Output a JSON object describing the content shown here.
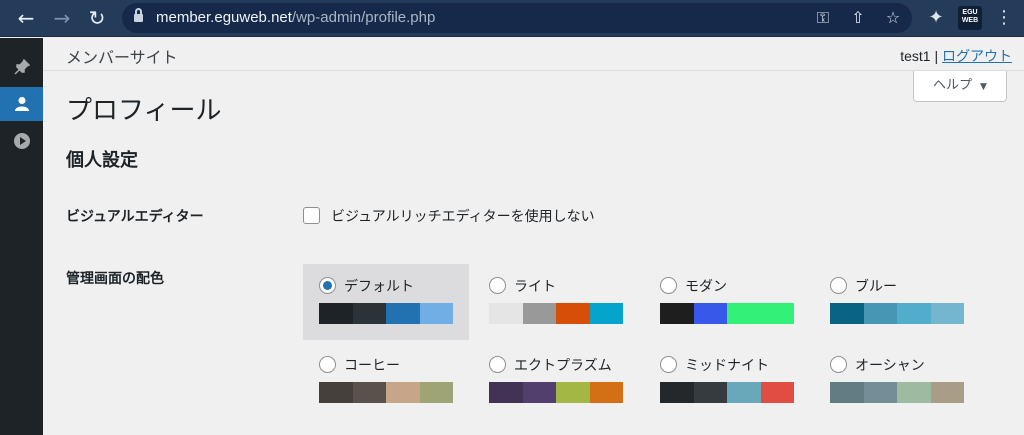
{
  "browser": {
    "url_host": "member.eguweb.net",
    "url_path": "/wp-admin/profile.php",
    "extension_logo_text": "EGU WEB"
  },
  "admin_bar": {
    "site_name": "メンバーサイト",
    "username": "test1",
    "separator": " | ",
    "logout_label": "ログアウト"
  },
  "sidebar": {
    "items": [
      {
        "icon": "pushpin-icon",
        "active": false
      },
      {
        "icon": "user-icon",
        "active": true
      },
      {
        "icon": "media-play-icon",
        "active": false
      }
    ]
  },
  "help_label": "ヘルプ",
  "page": {
    "title": "プロフィール",
    "section_title": "個人設定",
    "visual_editor": {
      "label": "ビジュアルエディター",
      "checkbox_label": "ビジュアルリッチエディターを使用しない",
      "checked": false
    },
    "color_scheme": {
      "label": "管理画面の配色",
      "selected": "デフォルト",
      "schemes": [
        {
          "name": "デフォルト",
          "colors": [
            "#1d2327",
            "#2c3338",
            "#2271b1",
            "#72aee6"
          ]
        },
        {
          "name": "ライト",
          "colors": [
            "#e5e5e5",
            "#999999",
            "#d64e07",
            "#04a4cc"
          ]
        },
        {
          "name": "モダン",
          "colors": [
            "#1e1e1e",
            "#3858e9",
            "#33f078",
            "#33f078"
          ]
        },
        {
          "name": "ブルー",
          "colors": [
            "#096484",
            "#4796b3",
            "#52accc",
            "#74b6ce"
          ]
        },
        {
          "name": "コーヒー",
          "colors": [
            "#46403c",
            "#59524c",
            "#c7a589",
            "#9ea476"
          ]
        },
        {
          "name": "エクトプラズム",
          "colors": [
            "#413256",
            "#523f6d",
            "#a3b745",
            "#d46f15"
          ]
        },
        {
          "name": "ミッドナイト",
          "colors": [
            "#25282b",
            "#363b3f",
            "#69a8bb",
            "#e14d43"
          ]
        },
        {
          "name": "オーシャン",
          "colors": [
            "#627c83",
            "#738e96",
            "#9ebaa0",
            "#aa9d88"
          ]
        }
      ]
    }
  }
}
